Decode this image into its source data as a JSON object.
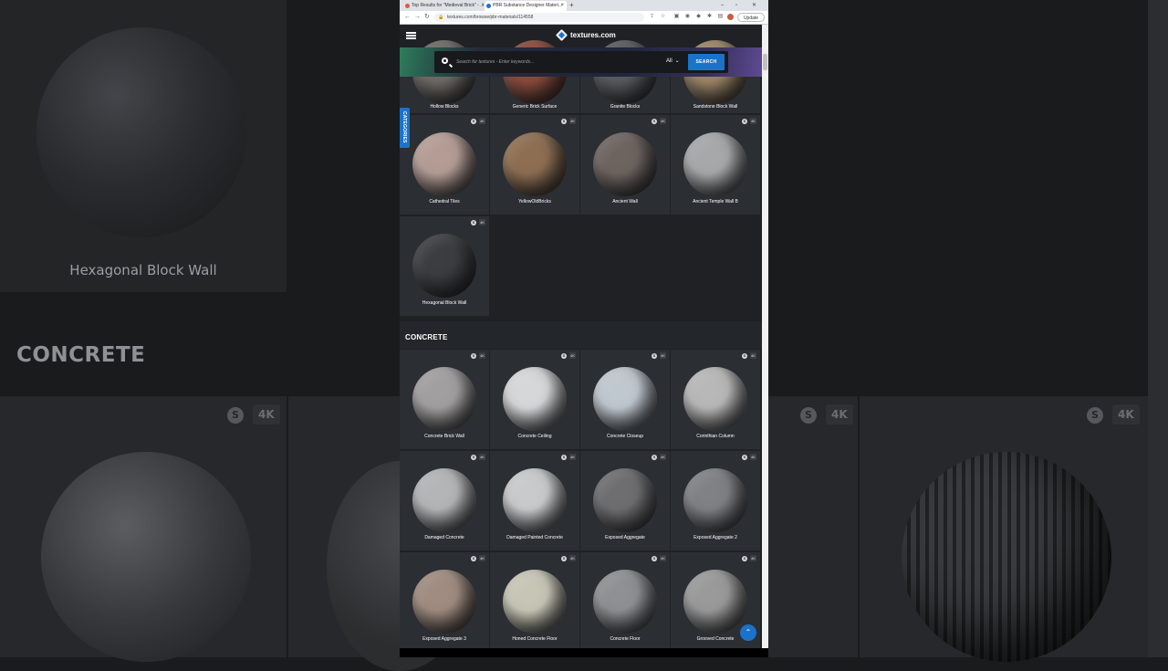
{
  "background": {
    "left_title": "Hexagonal Block Wall",
    "section": "CONCRETE",
    "badge_s": "S",
    "badge_4k": "4K"
  },
  "browser": {
    "tabs": [
      {
        "label": "Top Results for \"Medieval Brick\" - ...",
        "active": false
      },
      {
        "label": "PBR Substance Designer Materi...",
        "active": true
      }
    ],
    "new_tab": "+",
    "url": "textures.com/browse/pbr-materials/114558",
    "update_label": "Update"
  },
  "site": {
    "logo": "textures.com",
    "search": {
      "placeholder": "Search for textures - Enter keywords...",
      "filter": "All",
      "button": "SEARCH"
    },
    "categories_label": "CATEGORIES",
    "badge_s": "S",
    "badge_4k": "4K",
    "brick_top_row": [
      {
        "name": "Hollow Blocks",
        "color": "#6e6a66"
      },
      {
        "name": "Generic Brick Surface",
        "color": "#8a4a3c"
      },
      {
        "name": "Granite Blocks",
        "color": "#585a5e"
      },
      {
        "name": "Sandstone Block Wall",
        "color": "#9c8566"
      }
    ],
    "brick_row_2": [
      {
        "name": "Cathedral Tiles",
        "color": "#b59d96"
      },
      {
        "name": "YellowOldBricks",
        "color": "#8e6e52"
      },
      {
        "name": "Ancient Wall",
        "color": "#6d6460"
      },
      {
        "name": "Ancient Temple Wall B",
        "color": "#a6a8aa"
      }
    ],
    "brick_row_3": [
      {
        "name": "Hexagonal Block Wall",
        "color": "#3c3d40"
      }
    ],
    "concrete_title": "CONCRETE",
    "concrete_row_1": [
      {
        "name": "Concrete Brick Wall",
        "color": "#a29fa0"
      },
      {
        "name": "Concrete Ceiling",
        "color": "#d5d7d9"
      },
      {
        "name": "Concrete Closeup",
        "color": "#bfc7cf"
      },
      {
        "name": "Corinthian Column",
        "color": "#b8b8b8"
      }
    ],
    "concrete_row_2": [
      {
        "name": "Damaged Concrete",
        "color": "#b4b5b7"
      },
      {
        "name": "Damaged Painted Concrete",
        "color": "#c9cacc"
      },
      {
        "name": "Exposed Aggregate",
        "color": "#6e6e70"
      },
      {
        "name": "Exposed Aggregate 2",
        "color": "#808185"
      }
    ],
    "concrete_row_3": [
      {
        "name": "Exposed Aggregate 3",
        "color": "#a08c80"
      },
      {
        "name": "Honed Concrete Floor",
        "color": "#c7c6b6"
      },
      {
        "name": "Concrete Floor",
        "color": "#8e9093"
      },
      {
        "name": "Grooved Concrete",
        "color": "#9a9a9a"
      }
    ]
  }
}
